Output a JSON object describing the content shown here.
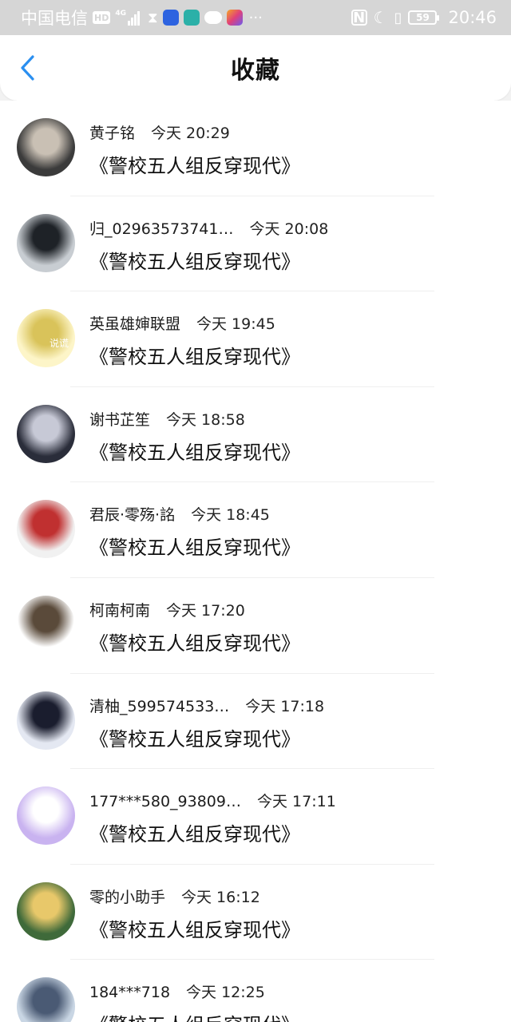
{
  "status_bar": {
    "carrier": "中国电信",
    "hd": "HD",
    "network": "4G",
    "battery": "59",
    "time": "20:46",
    "icons": [
      "signal-icon",
      "hourglass-icon",
      "bulb-app-icon",
      "book-app-icon",
      "wechat-icon",
      "app-icon",
      "more-dots-icon",
      "nfc-icon",
      "moon-icon",
      "vibrate-icon",
      "battery-icon"
    ]
  },
  "header": {
    "title": "收藏",
    "back_icon": "chevron-left-icon",
    "accent": "#2a8ff0"
  },
  "items": [
    {
      "name": "黄子铭",
      "time": "今天 20:29",
      "book": "《警校五人组反穿现代》",
      "avatar_colors": [
        "#3b3b3b",
        "#c9c0b4"
      ]
    },
    {
      "name": "归_02963573741…",
      "time": "今天 20:08",
      "book": "《警校五人组反穿现代》",
      "avatar_colors": [
        "#c8cdd2",
        "#1e2227"
      ]
    },
    {
      "name": "英虽雄婶联盟",
      "time": "今天 19:45",
      "book": "《警校五人组反穿现代》",
      "avatar_colors": [
        "#fdf5c8",
        "#d9c35a"
      ],
      "avatar_text": "说谎"
    },
    {
      "name": "谢书芷笙",
      "time": "今天 18:58",
      "book": "《警校五人组反穿现代》",
      "avatar_colors": [
        "#2a2d3a",
        "#c7c9d6"
      ]
    },
    {
      "name": "君辰·零殇·詺",
      "time": "今天 18:45",
      "book": "《警校五人组反穿现代》",
      "avatar_colors": [
        "#f1f1f1",
        "#c03030"
      ]
    },
    {
      "name": "柯南柯南",
      "time": "今天 17:20",
      "book": "《警校五人组反穿现代》",
      "avatar_colors": [
        "#ffffff",
        "#5a4a3a"
      ]
    },
    {
      "name": "清柚_599574533…",
      "time": "今天 17:18",
      "book": "《警校五人组反穿现代》",
      "avatar_colors": [
        "#e4e8f2",
        "#1a1d2e"
      ]
    },
    {
      "name": "177***580_93809…",
      "time": "今天 17:11",
      "book": "《警校五人组反穿现代》",
      "avatar_colors": [
        "#c9b3f0",
        "#ffffff"
      ]
    },
    {
      "name": "零的小助手",
      "time": "今天 16:12",
      "book": "《警校五人组反穿现代》",
      "avatar_colors": [
        "#3f6a3a",
        "#e8c86a"
      ]
    },
    {
      "name": "184***718",
      "time": "今天 12:25",
      "book": "《警校五人组反穿现代》",
      "avatar_colors": [
        "#c9d6e4",
        "#4a5a74"
      ]
    }
  ]
}
